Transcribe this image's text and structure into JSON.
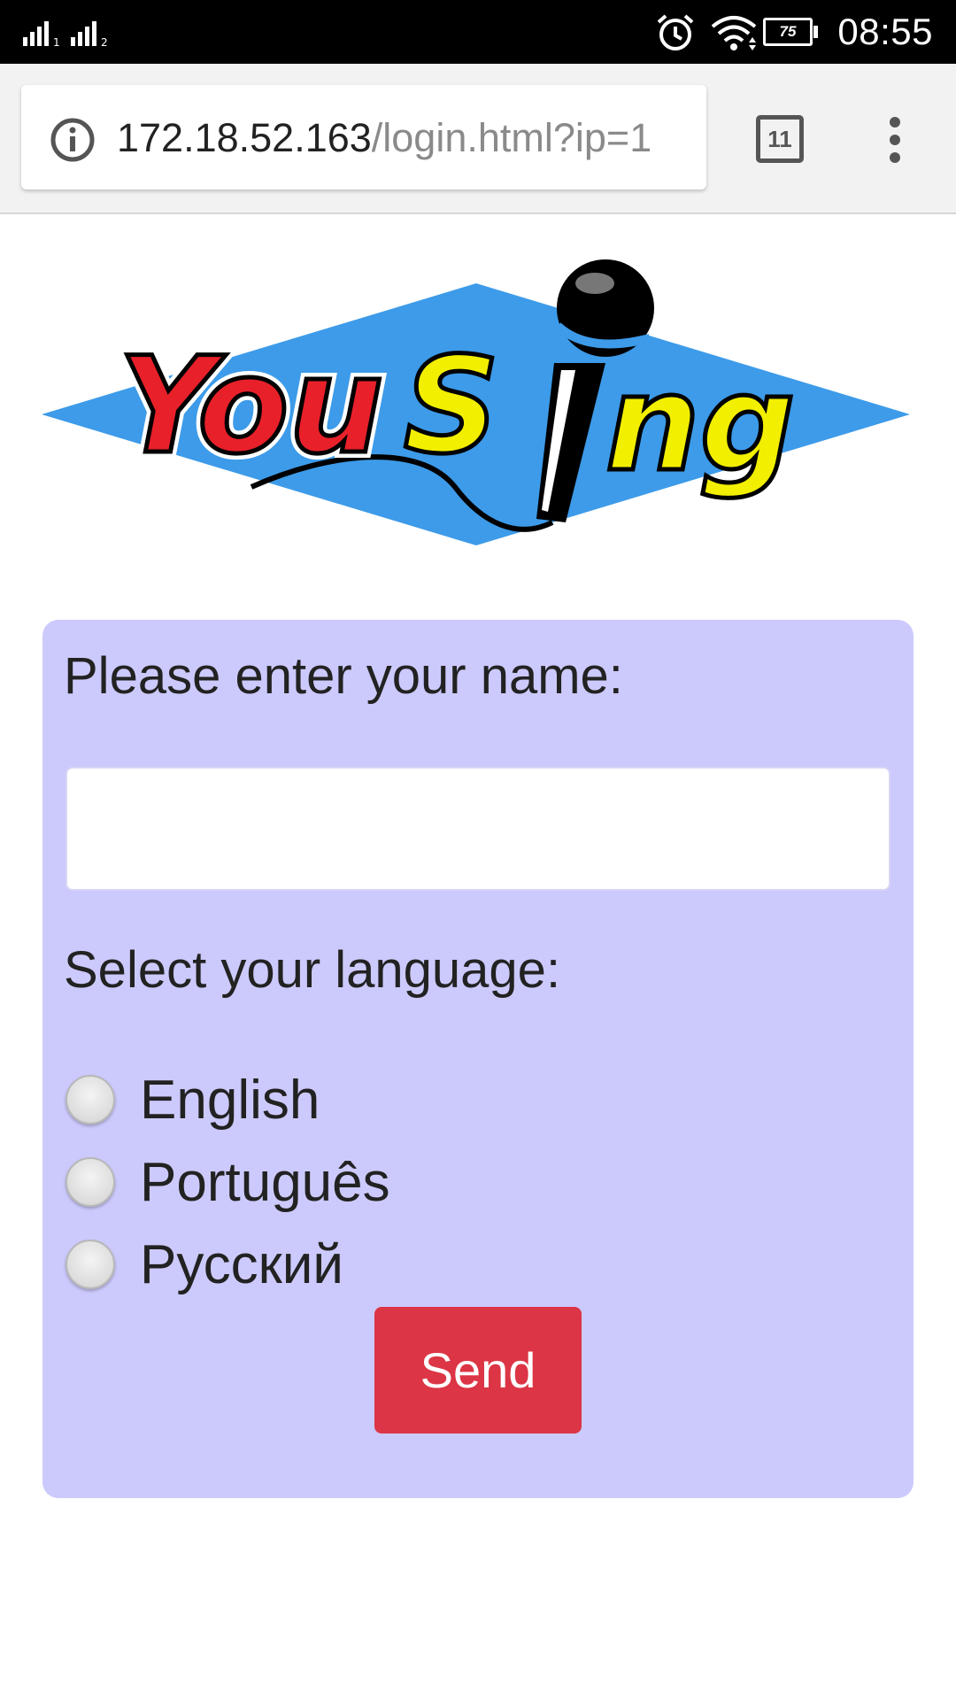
{
  "status_bar": {
    "time": "08:55",
    "battery_level": "75",
    "icons": [
      "signal-icon",
      "signal-icon",
      "alarm-icon",
      "wifi-icon",
      "battery-icon"
    ]
  },
  "browser": {
    "url_host": "172.18.52.163",
    "url_path": "/login.html?ip=1",
    "tab_count": "11",
    "icons": [
      "info-icon",
      "tabs-icon",
      "overflow-menu-icon"
    ]
  },
  "logo": {
    "text_you": "You",
    "text_s": "S",
    "text_ng": "ng",
    "colors": {
      "diamond": "#3d9be9",
      "you": "#e8202a",
      "sing": "#f2ef00"
    }
  },
  "form": {
    "name_label": "Please enter your name:",
    "name_value": "",
    "language_label": "Select your language:",
    "languages": [
      {
        "label": "English",
        "selected": false
      },
      {
        "label": "Português",
        "selected": false
      },
      {
        "label": "Русский",
        "selected": false
      }
    ],
    "send_label": "Send",
    "colors": {
      "panel": "#cccafc",
      "send_button": "#dc3545"
    }
  }
}
